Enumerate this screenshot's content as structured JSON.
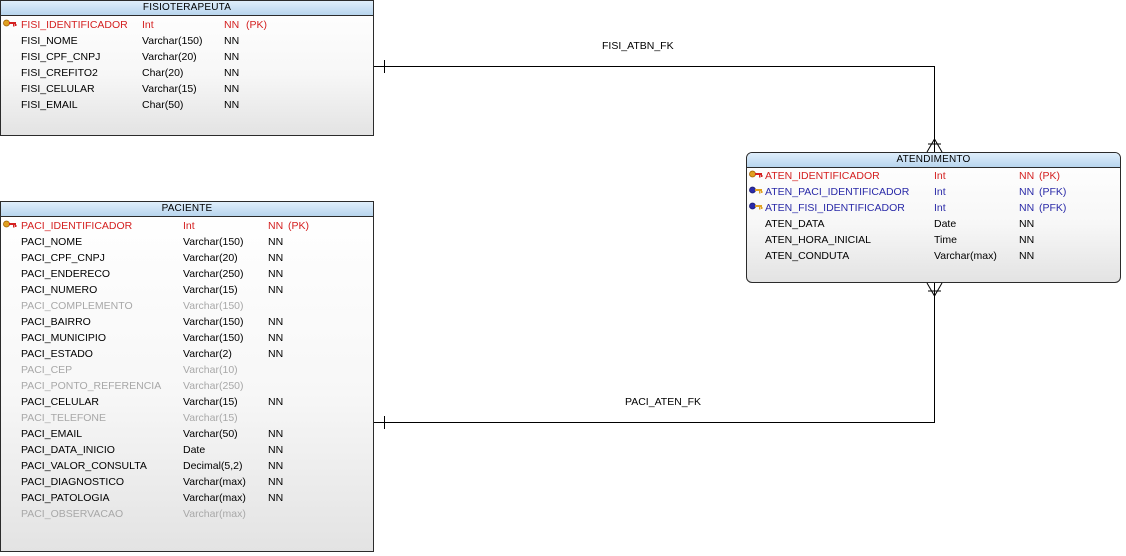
{
  "entities": {
    "fisioterapeuta": {
      "title": "FISIOTERAPEUTA",
      "columns": [
        {
          "name": "FISI_IDENTIFICADOR",
          "type": "Int",
          "nn": "NN",
          "key": "(PK)",
          "kind": "pk"
        },
        {
          "name": "FISI_NOME",
          "type": "Varchar(150)",
          "nn": "NN",
          "key": "",
          "kind": "normal"
        },
        {
          "name": "FISI_CPF_CNPJ",
          "type": "Varchar(20)",
          "nn": "NN",
          "key": "",
          "kind": "normal"
        },
        {
          "name": "FISI_CREFITO2",
          "type": "Char(20)",
          "nn": "NN",
          "key": "",
          "kind": "normal"
        },
        {
          "name": "FISI_CELULAR",
          "type": "Varchar(15)",
          "nn": "NN",
          "key": "",
          "kind": "normal"
        },
        {
          "name": "FISI_EMAIL",
          "type": "Char(50)",
          "nn": "NN",
          "key": "",
          "kind": "normal"
        }
      ]
    },
    "paciente": {
      "title": "PACIENTE",
      "columns": [
        {
          "name": "PACI_IDENTIFICADOR",
          "type": "Int",
          "nn": "NN",
          "key": "(PK)",
          "kind": "pk"
        },
        {
          "name": "PACI_NOME",
          "type": "Varchar(150)",
          "nn": "NN",
          "key": "",
          "kind": "normal"
        },
        {
          "name": "PACI_CPF_CNPJ",
          "type": "Varchar(20)",
          "nn": "NN",
          "key": "",
          "kind": "normal"
        },
        {
          "name": "PACI_ENDERECO",
          "type": "Varchar(250)",
          "nn": "NN",
          "key": "",
          "kind": "normal"
        },
        {
          "name": "PACI_NUMERO",
          "type": "Varchar(15)",
          "nn": "NN",
          "key": "",
          "kind": "normal"
        },
        {
          "name": "PACI_COMPLEMENTO",
          "type": "Varchar(150)",
          "nn": "",
          "key": "",
          "kind": "null"
        },
        {
          "name": "PACI_BAIRRO",
          "type": "Varchar(150)",
          "nn": "NN",
          "key": "",
          "kind": "normal"
        },
        {
          "name": "PACI_MUNICIPIO",
          "type": "Varchar(150)",
          "nn": "NN",
          "key": "",
          "kind": "normal"
        },
        {
          "name": "PACI_ESTADO",
          "type": "Varchar(2)",
          "nn": "NN",
          "key": "",
          "kind": "normal"
        },
        {
          "name": "PACI_CEP",
          "type": "Varchar(10)",
          "nn": "",
          "key": "",
          "kind": "null"
        },
        {
          "name": "PACI_PONTO_REFERENCIA",
          "type": "Varchar(250)",
          "nn": "",
          "key": "",
          "kind": "null"
        },
        {
          "name": "PACI_CELULAR",
          "type": "Varchar(15)",
          "nn": "NN",
          "key": "",
          "kind": "normal"
        },
        {
          "name": "PACI_TELEFONE",
          "type": "Varchar(15)",
          "nn": "",
          "key": "",
          "kind": "null"
        },
        {
          "name": "PACI_EMAIL",
          "type": "Varchar(50)",
          "nn": "NN",
          "key": "",
          "kind": "normal"
        },
        {
          "name": "PACI_DATA_INICIO",
          "type": "Date",
          "nn": "NN",
          "key": "",
          "kind": "normal"
        },
        {
          "name": "PACI_VALOR_CONSULTA",
          "type": "Decimal(5,2)",
          "nn": "NN",
          "key": "",
          "kind": "normal"
        },
        {
          "name": "PACI_DIAGNOSTICO",
          "type": "Varchar(max)",
          "nn": "NN",
          "key": "",
          "kind": "normal"
        },
        {
          "name": "PACI_PATOLOGIA",
          "type": "Varchar(max)",
          "nn": "NN",
          "key": "",
          "kind": "normal"
        },
        {
          "name": "PACI_OBSERVACAO",
          "type": "Varchar(max)",
          "nn": "",
          "key": "",
          "kind": "null"
        }
      ]
    },
    "atendimento": {
      "title": "ATENDIMENTO",
      "columns": [
        {
          "name": "ATEN_IDENTIFICADOR",
          "type": "Int",
          "nn": "NN",
          "key": "(PK)",
          "kind": "pk"
        },
        {
          "name": "ATEN_PACI_IDENTIFICADOR",
          "type": "Int",
          "nn": "NN",
          "key": "(PFK)",
          "kind": "pfk"
        },
        {
          "name": "ATEN_FISI_IDENTIFICADOR",
          "type": "Int",
          "nn": "NN",
          "key": "(PFK)",
          "kind": "pfk"
        },
        {
          "name": "ATEN_DATA",
          "type": "Date",
          "nn": "NN",
          "key": "",
          "kind": "normal"
        },
        {
          "name": "ATEN_HORA_INICIAL",
          "type": "Time",
          "nn": "NN",
          "key": "",
          "kind": "normal"
        },
        {
          "name": "ATEN_CONDUTA",
          "type": "Varchar(max)",
          "nn": "NN",
          "key": "",
          "kind": "normal"
        }
      ]
    }
  },
  "relationships": {
    "fisi_atbn": {
      "label": "FISI_ATBN_FK"
    },
    "paci_aten": {
      "label": "PACI_ATEN_FK"
    }
  },
  "colors": {
    "pk": "#d42020",
    "pfk": "#2a2aa8",
    "nullable": "#a8a8a8",
    "header": "#b8d5ee"
  }
}
